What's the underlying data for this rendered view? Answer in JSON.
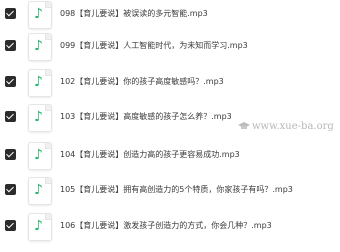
{
  "files": [
    {
      "name": "098【育儿要说】被误读的多元智能.mp3",
      "checked": true,
      "icon": "music-note-icon"
    },
    {
      "name": "099【育儿要说】人工智能时代，为未知而学习.mp3",
      "checked": true,
      "icon": "music-note-icon"
    },
    {
      "name": "102【育儿要说】你的孩子高度敏感吗？.mp3",
      "checked": true,
      "icon": "music-note-icon"
    },
    {
      "name": "103【育儿要说】高度敏感的孩子怎么养？.mp3",
      "checked": true,
      "icon": "music-note-icon"
    },
    {
      "name": "104【育儿要说】创造力高的孩子更容易成功.mp3",
      "checked": true,
      "icon": "music-note-icon"
    },
    {
      "name": "105【育儿要说】拥有高创造力的5个特质，你家孩子有吗？.mp3",
      "checked": true,
      "icon": "music-note-icon"
    },
    {
      "name": "106【育儿要说】激发孩子创造力的方式，你会几种？.mp3",
      "checked": true,
      "icon": "music-note-icon"
    }
  ],
  "watermark": "www.xue-ba.org",
  "colors": {
    "accent": "#24b46a",
    "checkbox": "#2b2b2b"
  }
}
